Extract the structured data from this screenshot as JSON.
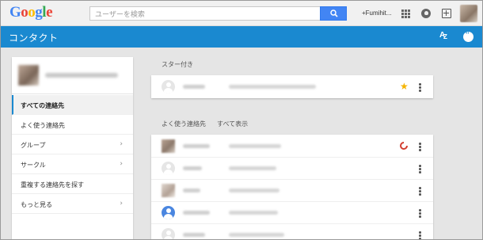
{
  "topbar": {
    "logo": [
      "G",
      "o",
      "o",
      "g",
      "l",
      "e"
    ],
    "logo_colors": [
      "#4285f4",
      "#ea4335",
      "#fbbc05",
      "#4285f4",
      "#34a853",
      "#ea4335"
    ],
    "search_placeholder": "ユーザーを検索",
    "user_name": "+Fumihit..."
  },
  "header": {
    "title": "コンタクト",
    "sort_label": "AZ",
    "colors": {
      "header_bg": "#1a89d0"
    }
  },
  "sidebar": {
    "items": [
      {
        "label": "すべての連絡先",
        "active": true,
        "chevron": false
      },
      {
        "label": "よく使う連絡先",
        "active": false,
        "chevron": false
      },
      {
        "label": "グループ",
        "active": false,
        "chevron": true
      },
      {
        "label": "サークル",
        "active": false,
        "chevron": true
      },
      {
        "label": "重複する連絡先を探す",
        "active": false,
        "chevron": false
      },
      {
        "label": "もっと見る",
        "active": false,
        "chevron": true
      }
    ]
  },
  "starred": {
    "label": "スター付き"
  },
  "frequent": {
    "label": "よく使う連絡先",
    "show_all": "すべて表示"
  },
  "icons": {
    "search": "search-icon",
    "apps": "apps-grid-icon",
    "notifications": "notification-icon",
    "share": "share-icon",
    "sort": "sort-az-icon",
    "chat": "chat-icon",
    "star": "star-icon",
    "more": "more-vert-icon",
    "gplus": "google-plus-circle-icon"
  }
}
